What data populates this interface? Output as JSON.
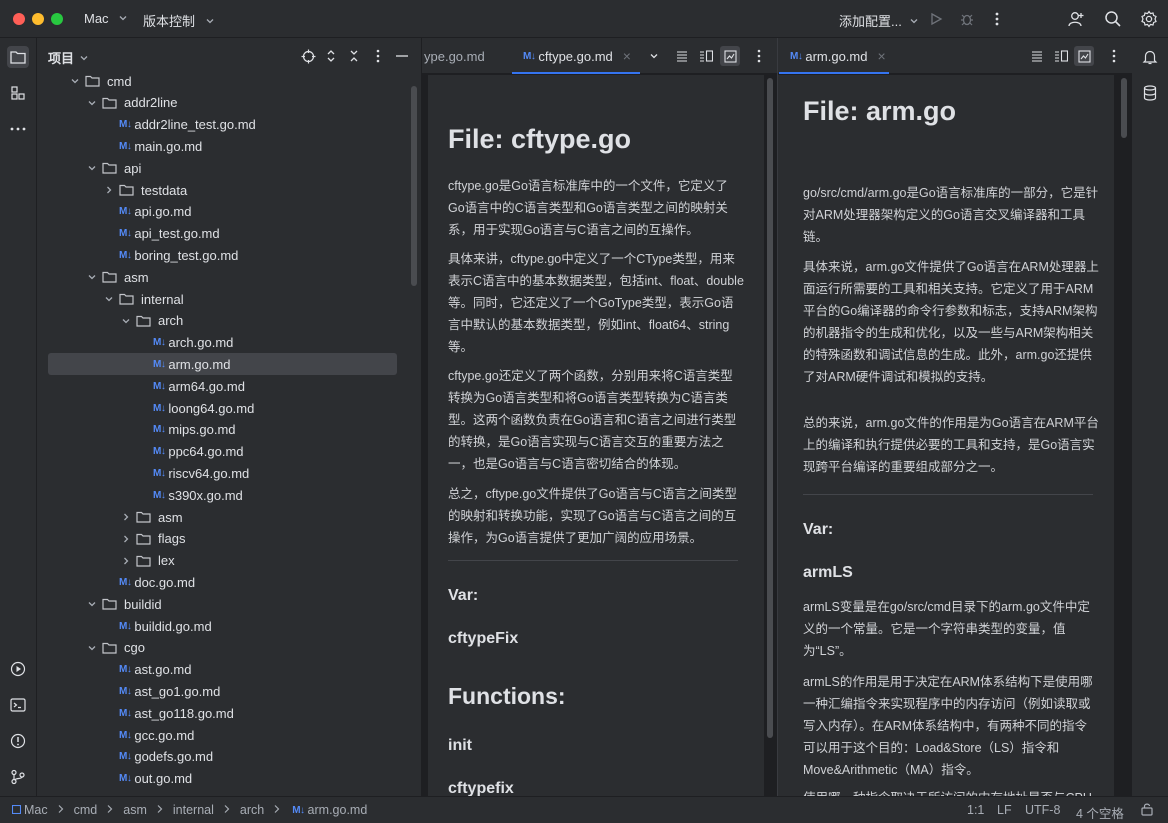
{
  "titlebar": {
    "project_name": "Mac",
    "vcs": "版本控制",
    "run_config": "添加配置..."
  },
  "project_panel": {
    "title": "项目",
    "tree": [
      {
        "label": "cmd",
        "type": "folder",
        "depth": 0,
        "expanded": true
      },
      {
        "label": "addr2line",
        "type": "folder",
        "depth": 1,
        "expanded": true
      },
      {
        "label": "addr2line_test.go.md",
        "type": "md",
        "depth": 2
      },
      {
        "label": "main.go.md",
        "type": "md",
        "depth": 2
      },
      {
        "label": "api",
        "type": "folder",
        "depth": 1,
        "expanded": true
      },
      {
        "label": "testdata",
        "type": "folder",
        "depth": 2,
        "expanded": false
      },
      {
        "label": "api.go.md",
        "type": "md",
        "depth": 2
      },
      {
        "label": "api_test.go.md",
        "type": "md",
        "depth": 2
      },
      {
        "label": "boring_test.go.md",
        "type": "md",
        "depth": 2
      },
      {
        "label": "asm",
        "type": "folder",
        "depth": 1,
        "expanded": true
      },
      {
        "label": "internal",
        "type": "folder",
        "depth": 2,
        "expanded": true
      },
      {
        "label": "arch",
        "type": "folder",
        "depth": 3,
        "expanded": true
      },
      {
        "label": "arch.go.md",
        "type": "md",
        "depth": 4
      },
      {
        "label": "arm.go.md",
        "type": "md",
        "depth": 4,
        "selected": true
      },
      {
        "label": "arm64.go.md",
        "type": "md",
        "depth": 4
      },
      {
        "label": "loong64.go.md",
        "type": "md",
        "depth": 4
      },
      {
        "label": "mips.go.md",
        "type": "md",
        "depth": 4
      },
      {
        "label": "ppc64.go.md",
        "type": "md",
        "depth": 4
      },
      {
        "label": "riscv64.go.md",
        "type": "md",
        "depth": 4
      },
      {
        "label": "s390x.go.md",
        "type": "md",
        "depth": 4
      },
      {
        "label": "asm",
        "type": "folder",
        "depth": 3,
        "expanded": false
      },
      {
        "label": "flags",
        "type": "folder",
        "depth": 3,
        "expanded": false
      },
      {
        "label": "lex",
        "type": "folder",
        "depth": 3,
        "expanded": false
      },
      {
        "label": "doc.go.md",
        "type": "md",
        "depth": 2
      },
      {
        "label": "buildid",
        "type": "folder",
        "depth": 1,
        "expanded": true
      },
      {
        "label": "buildid.go.md",
        "type": "md",
        "depth": 2
      },
      {
        "label": "cgo",
        "type": "folder",
        "depth": 1,
        "expanded": true
      },
      {
        "label": "ast.go.md",
        "type": "md",
        "depth": 2
      },
      {
        "label": "ast_go1.go.md",
        "type": "md",
        "depth": 2
      },
      {
        "label": "ast_go118.go.md",
        "type": "md",
        "depth": 2
      },
      {
        "label": "gcc.go.md",
        "type": "md",
        "depth": 2
      },
      {
        "label": "godefs.go.md",
        "type": "md",
        "depth": 2
      },
      {
        "label": "out.go.md",
        "type": "md",
        "depth": 2
      }
    ]
  },
  "editor_left": {
    "tabs": [
      {
        "label": "ype.go.md"
      },
      {
        "label": "cftype.go.md",
        "active": true
      }
    ],
    "preview": {
      "h1": "File: cftype.go",
      "paragraphs": [
        "cftype.go是Go语言标准库中的一个文件，它定义了Go语言中的C语言类型和Go语言类型之间的映射关系，用于实现Go语言与C语言之间的互操作。",
        "具体来讲，cftype.go中定义了一个CType类型，用来表示C语言中的基本数据类型，包括int、float、double等。同时，它还定义了一个GoType类型，表示Go语言中默认的基本数据类型，例如int、float64、string等。",
        "cftype.go还定义了两个函数，分别用来将C语言类型转换为Go语言类型和将Go语言类型转换为C语言类型。这两个函数负责在Go语言和C语言之间进行类型的转换，是Go语言实现与C语言交互的重要方法之一，也是Go语言与C语言密切结合的体现。",
        "总之，cftype.go文件提供了Go语言与C语言之间类型的映射和转换功能，实现了Go语言与C语言之间的互操作，为Go语言提供了更加广阔的应用场景。"
      ],
      "var_heading": "Var:",
      "var_name": "cftypeFix",
      "func_heading": "Functions:",
      "func_init": "init",
      "func_cftypefix": "cftypefix"
    }
  },
  "editor_right": {
    "tabs": [
      {
        "label": "arm.go.md",
        "active": true
      }
    ],
    "preview": {
      "h1": "File: arm.go",
      "paragraphs": [
        "go/src/cmd/arm.go是Go语言标准库的一部分，它是针对ARM处理器架构定义的Go语言交叉编译器和工具链。",
        "具体来说，arm.go文件提供了Go语言在ARM处理器上面运行所需要的工具和相关支持。它定义了用于ARM平台的Go编译器的命令行参数和标志，支持ARM架构的机器指令的生成和优化，以及一些与ARM架构相关的特殊函数和调试信息的生成。此外，arm.go还提供了对ARM硬件调试和模拟的支持。",
        "总的来说，arm.go文件的作用是为Go语言在ARM平台上的编译和执行提供必要的工具和支持，是Go语言实现跨平台编译的重要组成部分之一。"
      ],
      "var_heading": "Var:",
      "var_name": "armLS",
      "var_paragraphs": [
        "armLS变量是在go/src/cmd目录下的arm.go文件中定义的一个常量。它是一个字符串类型的变量，值为“LS”。",
        "armLS的作用是用于决定在ARM体系结构下是使用哪一种汇编指令来实现程序中的内存访问（例如读取或写入内存）。在ARM体系结构中，有两种不同的指令可以用于这个目的：Load&Store（LS）指令和Move&Arithmetic（MA）指令。",
        "使用哪一种指令取决于所访问的内存地址是否与CPU寄存器对齐，以及所使用的指令是否支持对非"
      ]
    }
  },
  "statusbar": {
    "breadcrumb": [
      "Mac",
      "cmd",
      "asm",
      "internal",
      "arch",
      "arm.go.md"
    ],
    "position": "1:1",
    "line_sep": "LF",
    "encoding": "UTF-8",
    "indent": "4 个空格"
  },
  "colors": {
    "accent": "#3574f0",
    "md_icon": "#548af7",
    "panel_bg": "#2b2d30",
    "editor_bg": "#1e1f22"
  }
}
